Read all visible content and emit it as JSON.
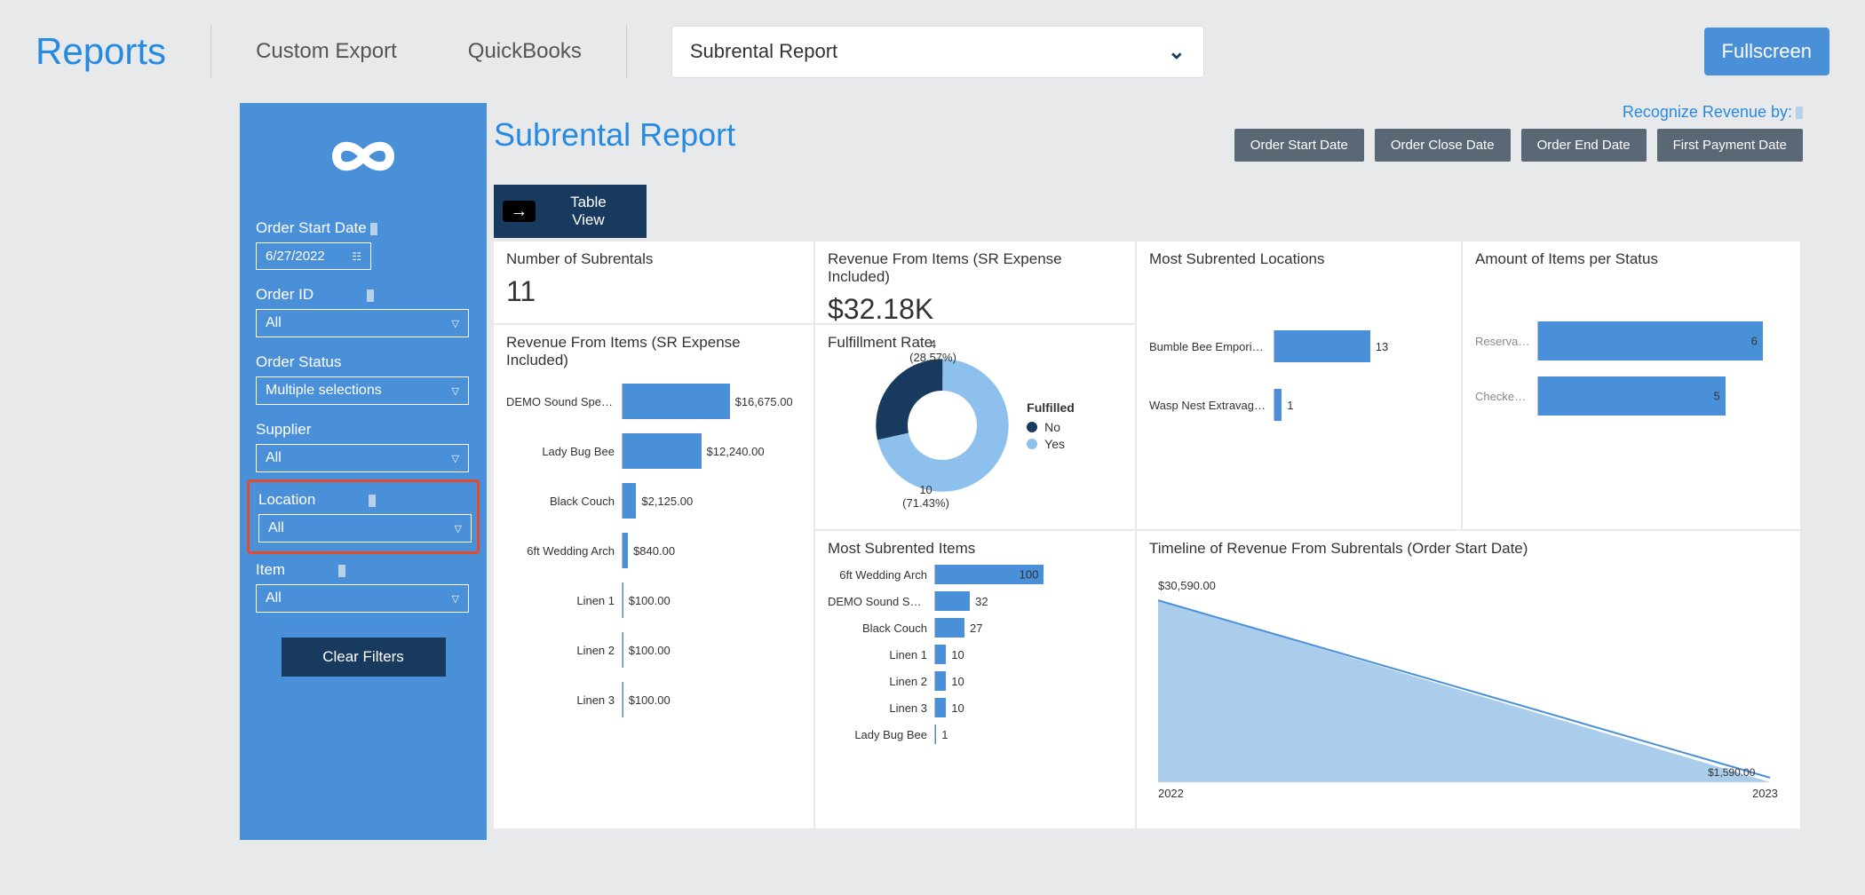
{
  "topbar": {
    "title": "Reports",
    "tab_custom_export": "Custom Export",
    "tab_quickbooks": "QuickBooks",
    "dropdown_value": "Subrental Report",
    "fullscreen": "Fullscreen"
  },
  "sidebar": {
    "order_start_date_label": "Order Start Date",
    "order_start_date_value": "6/27/2022",
    "order_id_label": "Order ID",
    "order_id_value": "All",
    "order_status_label": "Order Status",
    "order_status_value": "Multiple selections",
    "supplier_label": "Supplier",
    "supplier_value": "All",
    "location_label": "Location",
    "location_value": "All",
    "item_label": "Item",
    "item_value": "All",
    "clear_filters": "Clear Filters"
  },
  "main": {
    "report_title": "Subrental Report",
    "recognize_label": "Recognize Revenue by:",
    "rev_buttons": {
      "b1": "Order Start Date",
      "b2": "Order Close Date",
      "b3": "Order End Date",
      "b4": "First Payment Date"
    },
    "table_view": "Table View"
  },
  "tiles": {
    "num_sub_title": "Number of Subrentals",
    "num_sub_value": "11",
    "rev_total_title": "Revenue From Items (SR Expense Included)",
    "rev_total_value": "$32.18K",
    "rev_items_title": "Revenue From Items (SR Expense Included)",
    "fulfill_title": "Fulfillment Rate",
    "most_loc_title": "Most Subrented Locations",
    "status_title": "Amount of Items per Status",
    "most_items_title": "Most Subrented Items",
    "timeline_title": "Timeline of Revenue From Subrentals (Order Start Date)"
  },
  "chart_data": [
    {
      "id": "rev_items",
      "type": "bar",
      "orientation": "horizontal",
      "title": "Revenue From Items (SR Expense Included)",
      "categories": [
        "DEMO Sound Speaker",
        "Lady Bug Bee",
        "Black Couch",
        "6ft Wedding Arch",
        "Linen 1",
        "Linen 2",
        "Linen 3"
      ],
      "values": [
        16675.0,
        12240.0,
        2125.0,
        840.0,
        100.0,
        100.0,
        100.0
      ],
      "value_labels": [
        "$16,675.00",
        "$12,240.00",
        "$2,125.00",
        "$840.00",
        "$100.00",
        "$100.00",
        "$100.00"
      ]
    },
    {
      "id": "fulfillment",
      "type": "pie",
      "title": "Fulfillment Rate",
      "legend_title": "Fulfilled",
      "series": [
        {
          "name": "No",
          "value": 4,
          "pct": "28.57%",
          "color": "#173a5e"
        },
        {
          "name": "Yes",
          "value": 10,
          "pct": "71.43%",
          "color": "#8ec0ee"
        }
      ]
    },
    {
      "id": "most_locations",
      "type": "bar",
      "orientation": "horizontal",
      "title": "Most Subrented Locations",
      "categories": [
        "Bumble Bee Emporium",
        "Wasp Nest Extravaga..."
      ],
      "values": [
        13,
        1
      ]
    },
    {
      "id": "status",
      "type": "bar",
      "orientation": "horizontal",
      "title": "Amount of Items per Status",
      "categories": [
        "Reservation",
        "Checked In"
      ],
      "values": [
        6,
        5
      ]
    },
    {
      "id": "most_items",
      "type": "bar",
      "orientation": "horizontal",
      "title": "Most Subrented Items",
      "categories": [
        "6ft Wedding Arch",
        "DEMO Sound Speaker",
        "Black Couch",
        "Linen 1",
        "Linen 2",
        "Linen 3",
        "Lady Bug Bee"
      ],
      "values": [
        100,
        32,
        27,
        10,
        10,
        10,
        1
      ]
    },
    {
      "id": "timeline",
      "type": "area",
      "title": "Timeline of Revenue From Subrentals (Order Start Date)",
      "x": [
        "2022",
        "2023"
      ],
      "y": [
        30590.0,
        1590.0
      ],
      "y_labels": [
        "$30,590.00",
        "$1,590.00"
      ]
    }
  ]
}
